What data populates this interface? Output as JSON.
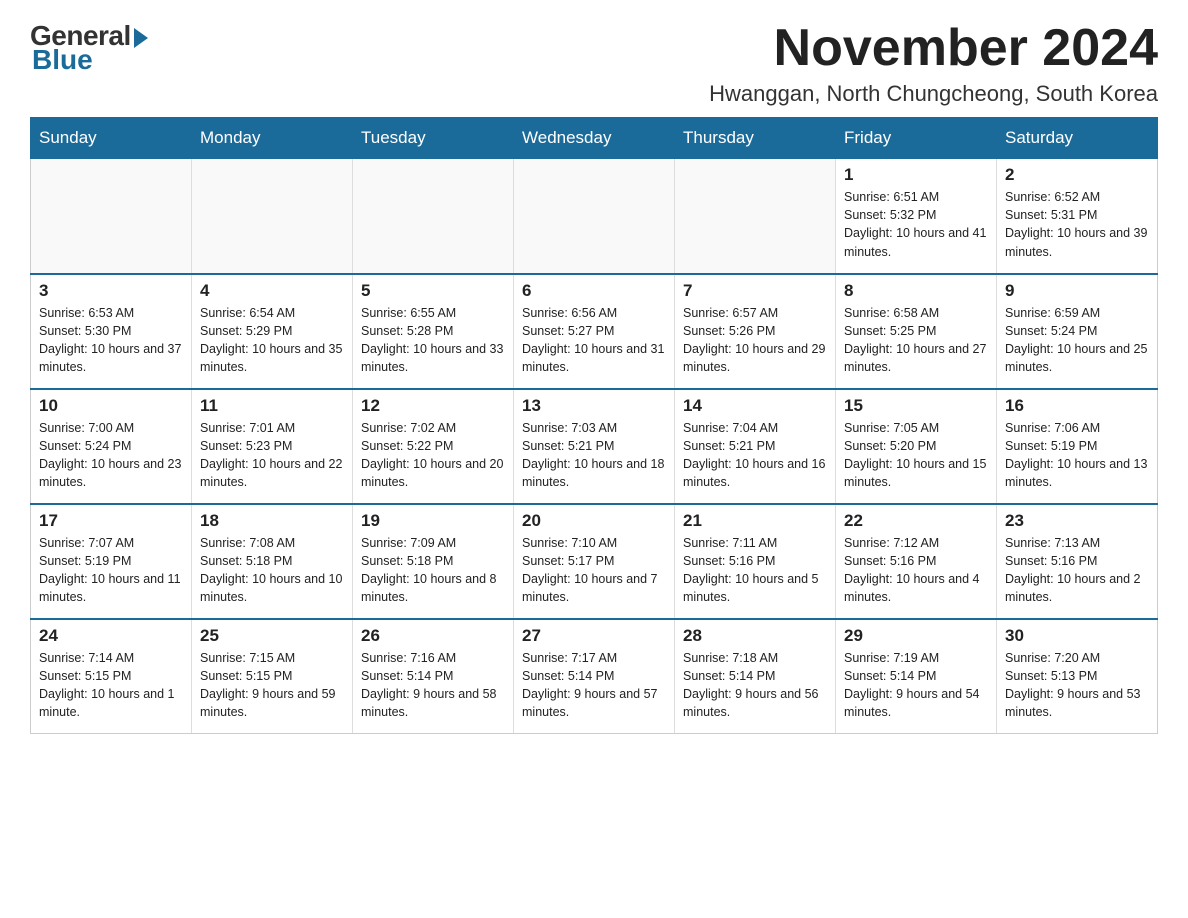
{
  "header": {
    "logo_general": "General",
    "logo_blue": "Blue",
    "month_title": "November 2024",
    "location": "Hwanggan, North Chungcheong, South Korea"
  },
  "weekdays": [
    "Sunday",
    "Monday",
    "Tuesday",
    "Wednesday",
    "Thursday",
    "Friday",
    "Saturday"
  ],
  "weeks": [
    [
      {
        "day": "",
        "info": ""
      },
      {
        "day": "",
        "info": ""
      },
      {
        "day": "",
        "info": ""
      },
      {
        "day": "",
        "info": ""
      },
      {
        "day": "",
        "info": ""
      },
      {
        "day": "1",
        "info": "Sunrise: 6:51 AM\nSunset: 5:32 PM\nDaylight: 10 hours and 41 minutes."
      },
      {
        "day": "2",
        "info": "Sunrise: 6:52 AM\nSunset: 5:31 PM\nDaylight: 10 hours and 39 minutes."
      }
    ],
    [
      {
        "day": "3",
        "info": "Sunrise: 6:53 AM\nSunset: 5:30 PM\nDaylight: 10 hours and 37 minutes."
      },
      {
        "day": "4",
        "info": "Sunrise: 6:54 AM\nSunset: 5:29 PM\nDaylight: 10 hours and 35 minutes."
      },
      {
        "day": "5",
        "info": "Sunrise: 6:55 AM\nSunset: 5:28 PM\nDaylight: 10 hours and 33 minutes."
      },
      {
        "day": "6",
        "info": "Sunrise: 6:56 AM\nSunset: 5:27 PM\nDaylight: 10 hours and 31 minutes."
      },
      {
        "day": "7",
        "info": "Sunrise: 6:57 AM\nSunset: 5:26 PM\nDaylight: 10 hours and 29 minutes."
      },
      {
        "day": "8",
        "info": "Sunrise: 6:58 AM\nSunset: 5:25 PM\nDaylight: 10 hours and 27 minutes."
      },
      {
        "day": "9",
        "info": "Sunrise: 6:59 AM\nSunset: 5:24 PM\nDaylight: 10 hours and 25 minutes."
      }
    ],
    [
      {
        "day": "10",
        "info": "Sunrise: 7:00 AM\nSunset: 5:24 PM\nDaylight: 10 hours and 23 minutes."
      },
      {
        "day": "11",
        "info": "Sunrise: 7:01 AM\nSunset: 5:23 PM\nDaylight: 10 hours and 22 minutes."
      },
      {
        "day": "12",
        "info": "Sunrise: 7:02 AM\nSunset: 5:22 PM\nDaylight: 10 hours and 20 minutes."
      },
      {
        "day": "13",
        "info": "Sunrise: 7:03 AM\nSunset: 5:21 PM\nDaylight: 10 hours and 18 minutes."
      },
      {
        "day": "14",
        "info": "Sunrise: 7:04 AM\nSunset: 5:21 PM\nDaylight: 10 hours and 16 minutes."
      },
      {
        "day": "15",
        "info": "Sunrise: 7:05 AM\nSunset: 5:20 PM\nDaylight: 10 hours and 15 minutes."
      },
      {
        "day": "16",
        "info": "Sunrise: 7:06 AM\nSunset: 5:19 PM\nDaylight: 10 hours and 13 minutes."
      }
    ],
    [
      {
        "day": "17",
        "info": "Sunrise: 7:07 AM\nSunset: 5:19 PM\nDaylight: 10 hours and 11 minutes."
      },
      {
        "day": "18",
        "info": "Sunrise: 7:08 AM\nSunset: 5:18 PM\nDaylight: 10 hours and 10 minutes."
      },
      {
        "day": "19",
        "info": "Sunrise: 7:09 AM\nSunset: 5:18 PM\nDaylight: 10 hours and 8 minutes."
      },
      {
        "day": "20",
        "info": "Sunrise: 7:10 AM\nSunset: 5:17 PM\nDaylight: 10 hours and 7 minutes."
      },
      {
        "day": "21",
        "info": "Sunrise: 7:11 AM\nSunset: 5:16 PM\nDaylight: 10 hours and 5 minutes."
      },
      {
        "day": "22",
        "info": "Sunrise: 7:12 AM\nSunset: 5:16 PM\nDaylight: 10 hours and 4 minutes."
      },
      {
        "day": "23",
        "info": "Sunrise: 7:13 AM\nSunset: 5:16 PM\nDaylight: 10 hours and 2 minutes."
      }
    ],
    [
      {
        "day": "24",
        "info": "Sunrise: 7:14 AM\nSunset: 5:15 PM\nDaylight: 10 hours and 1 minute."
      },
      {
        "day": "25",
        "info": "Sunrise: 7:15 AM\nSunset: 5:15 PM\nDaylight: 9 hours and 59 minutes."
      },
      {
        "day": "26",
        "info": "Sunrise: 7:16 AM\nSunset: 5:14 PM\nDaylight: 9 hours and 58 minutes."
      },
      {
        "day": "27",
        "info": "Sunrise: 7:17 AM\nSunset: 5:14 PM\nDaylight: 9 hours and 57 minutes."
      },
      {
        "day": "28",
        "info": "Sunrise: 7:18 AM\nSunset: 5:14 PM\nDaylight: 9 hours and 56 minutes."
      },
      {
        "day": "29",
        "info": "Sunrise: 7:19 AM\nSunset: 5:14 PM\nDaylight: 9 hours and 54 minutes."
      },
      {
        "day": "30",
        "info": "Sunrise: 7:20 AM\nSunset: 5:13 PM\nDaylight: 9 hours and 53 minutes."
      }
    ]
  ]
}
